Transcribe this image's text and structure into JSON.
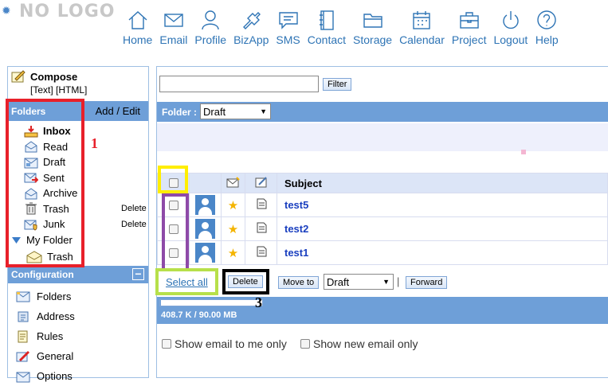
{
  "header": {
    "logo_text": "NO LOGO",
    "nav": [
      {
        "label": "Home",
        "icon": "home-icon"
      },
      {
        "label": "Email",
        "icon": "email-icon"
      },
      {
        "label": "Profile",
        "icon": "profile-icon"
      },
      {
        "label": "BizApp",
        "icon": "bizapp-icon"
      },
      {
        "label": "SMS",
        "icon": "sms-icon"
      },
      {
        "label": "Contact",
        "icon": "contact-icon"
      },
      {
        "label": "Storage",
        "icon": "storage-icon"
      },
      {
        "label": "Calendar",
        "icon": "calendar-icon"
      },
      {
        "label": "Project",
        "icon": "project-icon"
      },
      {
        "label": "Logout",
        "icon": "logout-icon"
      },
      {
        "label": "Help",
        "icon": "help-icon"
      }
    ]
  },
  "sidebar": {
    "compose_label": "Compose",
    "compose_formats": "[Text] [HTML]",
    "folders_title": "Folders",
    "add_edit_label": "Add / Edit",
    "folders": [
      {
        "label": "Inbox",
        "bold": true
      },
      {
        "label": "Read"
      },
      {
        "label": "Draft"
      },
      {
        "label": "Sent"
      },
      {
        "label": "Archive"
      },
      {
        "label": "Trash",
        "action": "Delete"
      },
      {
        "label": "Junk",
        "action": "Delete"
      }
    ],
    "my_folder_label": "My Folder",
    "my_folder_children": [
      {
        "label": "Trash"
      }
    ],
    "configuration_title": "Configuration",
    "configuration_toggle": "−",
    "config_items": [
      {
        "label": "Folders"
      },
      {
        "label": "Address"
      },
      {
        "label": "Rules"
      },
      {
        "label": "General"
      },
      {
        "label": "Options"
      }
    ]
  },
  "main": {
    "filter_label": "Filter",
    "search_value": "",
    "folder_label": "Folder :",
    "folder_selected": "Draft",
    "table_header_subject": "Subject",
    "emails": [
      {
        "subject": "test5"
      },
      {
        "subject": "test2"
      },
      {
        "subject": "test1"
      }
    ],
    "select_all_label": "Select all",
    "delete_label": "Delete",
    "move_to_label": "Move to",
    "move_to_selected": "Draft",
    "separator": "|",
    "forward_label": "Forward",
    "quota_text": "408.7 K / 90.00 MB",
    "quota_fraction": 0.0044,
    "show_to_me_label": "Show email to me only",
    "show_new_label": "Show new email only"
  },
  "annotations": {
    "label_1": "1",
    "label_3": "3",
    "colors": {
      "red": "#e8202a",
      "yellow": "#ffee00",
      "purple": "#8e4aa8",
      "green": "#b7e04a",
      "black": "#000000"
    }
  }
}
